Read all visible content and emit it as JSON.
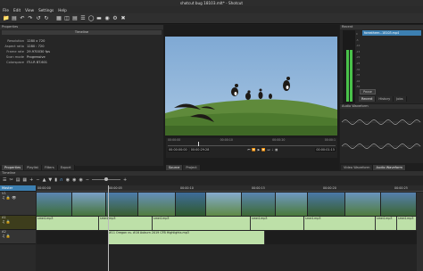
{
  "window": {
    "title": "shotcut bug 18103.mlt* - Shotcut"
  },
  "menu": [
    "File",
    "Edit",
    "View",
    "Settings",
    "Help"
  ],
  "toolbar_icons": [
    "open-icon",
    "save-icon",
    "undo-icon",
    "redo-icon",
    "undo-icon",
    "redo-icon",
    "peak-meter-icon",
    "properties-icon",
    "recent-icon",
    "playlist-icon",
    "history-icon",
    "timeline-icon",
    "filters-icon",
    "encode-icon",
    "export-icon"
  ],
  "properties": {
    "header": "Properties",
    "section": "Timeline",
    "fields": [
      {
        "k": "Resolution",
        "v": "1280 x 720"
      },
      {
        "k": "Aspect ratio",
        "v": "1280 : 720"
      },
      {
        "k": "Frame rate",
        "v": "29.970030 fps"
      },
      {
        "k": "Scan mode",
        "v": "Progressive"
      },
      {
        "k": "Colorspace",
        "v": "ITU-R BT.601"
      }
    ],
    "bottom_tabs": [
      "Properties",
      "Playlist",
      "Filters",
      "Export"
    ]
  },
  "player": {
    "timecode_left": "00:00:00:00",
    "timecode_current": "00:00:29:28",
    "timecode_right": "00:00:01:15",
    "ruler": [
      "00:00:00",
      "00:00:10",
      "00:00:20",
      "00:00:1"
    ],
    "tabs": [
      "Source",
      "Project"
    ]
  },
  "right_panel": {
    "header": "Recent",
    "file": "foreatheer...18103.mp4",
    "meter_labels": [
      "0",
      "-5",
      "-10",
      "-15",
      "-20",
      "-25",
      "-30",
      "-35",
      "-40",
      "-50"
    ],
    "pause_label": "Pause",
    "tabs": [
      "Recent",
      "History",
      "Jobs"
    ],
    "waveform_header": "Audio Waveform",
    "bottom_tabs": [
      "Video Waveform",
      "Audio Waveform"
    ]
  },
  "timeline": {
    "header": "Timeline",
    "ruler": [
      "00:00:00",
      "00:00:05",
      "00:00:10",
      "00:00:15",
      "00:00:20",
      "00:00:25"
    ],
    "tracks": [
      {
        "name": "Master"
      },
      {
        "name": "V1"
      },
      {
        "name": "A1"
      },
      {
        "name": "A2"
      }
    ],
    "a1_clips": [
      "sme4.mp3",
      "sme4.mp3",
      "sme4.mp3",
      "sme4.mp3",
      "sme4.mp3",
      "sme4.mp3",
      "sme4.mp3"
    ],
    "a2_clip": "#11 Oregon vs. #16 Auburn 2019 CFB Highlights.mp3"
  },
  "colors": {
    "accent": "#3c7fb1",
    "green_audio": "#bde0a8",
    "meter_green": "#49c24a"
  }
}
